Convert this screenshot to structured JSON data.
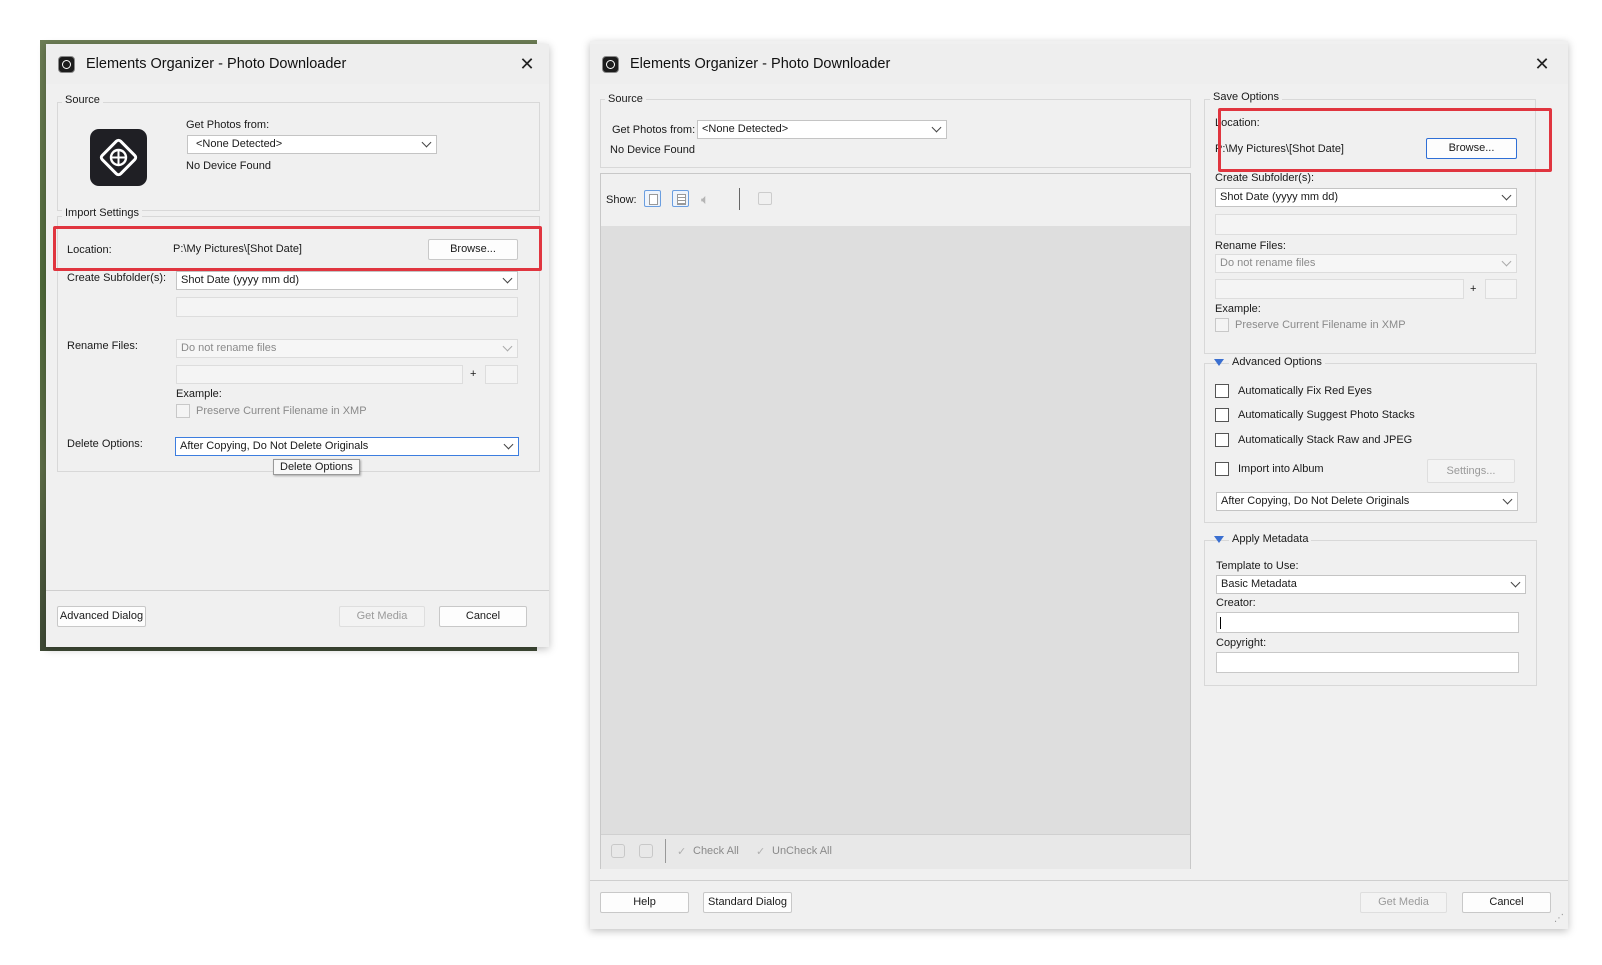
{
  "left_dialog": {
    "title": "Elements Organizer - Photo Downloader",
    "source": {
      "legend": "Source",
      "get_photos_label": "Get Photos from:",
      "device_value": "<None Detected>",
      "status": "No Device Found"
    },
    "import_settings": {
      "legend": "Import Settings",
      "location_label": "Location:",
      "location_value": "P:\\My Pictures\\[Shot Date]",
      "browse_label": "Browse...",
      "subfolder_label": "Create Subfolder(s):",
      "subfolder_value": "Shot Date (yyyy mm dd)",
      "rename_label": "Rename Files:",
      "rename_value": "Do not rename files",
      "plus": "+",
      "example_label": "Example:",
      "preserve_label": "Preserve Current Filename in XMP",
      "delete_label": "Delete Options:",
      "delete_value": "After Copying, Do Not Delete Originals",
      "tooltip": "Delete Options"
    },
    "buttons": {
      "advanced": "Advanced Dialog",
      "get_media": "Get Media",
      "cancel": "Cancel"
    }
  },
  "right_dialog": {
    "title": "Elements Organizer - Photo Downloader",
    "source": {
      "legend": "Source",
      "get_photos_label": "Get Photos from:",
      "device_value": "<None Detected>",
      "status": "No Device Found"
    },
    "toolbar": {
      "show_label": "Show:"
    },
    "bottom_bar": {
      "check_all": "Check All",
      "uncheck_all": "UnCheck All"
    },
    "save_options": {
      "legend": "Save Options",
      "location_label": "Location:",
      "location_value": "P:\\My Pictures\\[Shot Date]",
      "browse_label": "Browse...",
      "subfolder_label": "Create Subfolder(s):",
      "subfolder_value": "Shot Date (yyyy mm dd)",
      "rename_label": "Rename Files:",
      "rename_value": "Do not rename files",
      "plus": "+",
      "example_label": "Example:",
      "preserve_label": "Preserve Current Filename in XMP"
    },
    "advanced_options": {
      "legend": "Advanced Options",
      "fix_red_eyes": "Automatically Fix Red Eyes",
      "suggest_stacks": "Automatically Suggest Photo Stacks",
      "stack_raw": "Automatically Stack Raw and JPEG",
      "import_album": "Import into Album",
      "settings_label": "Settings...",
      "delete_value": "After Copying, Do Not Delete Originals"
    },
    "apply_metadata": {
      "legend": "Apply Metadata",
      "template_label": "Template to Use:",
      "template_value": "Basic Metadata",
      "creator_label": "Creator:",
      "copyright_label": "Copyright:"
    },
    "buttons": {
      "help": "Help",
      "standard": "Standard Dialog",
      "get_media": "Get Media",
      "cancel": "Cancel"
    }
  },
  "colors": {
    "highlight_box": "#e0353f",
    "accent": "#2f6fd6",
    "dialog_bg": "#f0f0f0"
  }
}
